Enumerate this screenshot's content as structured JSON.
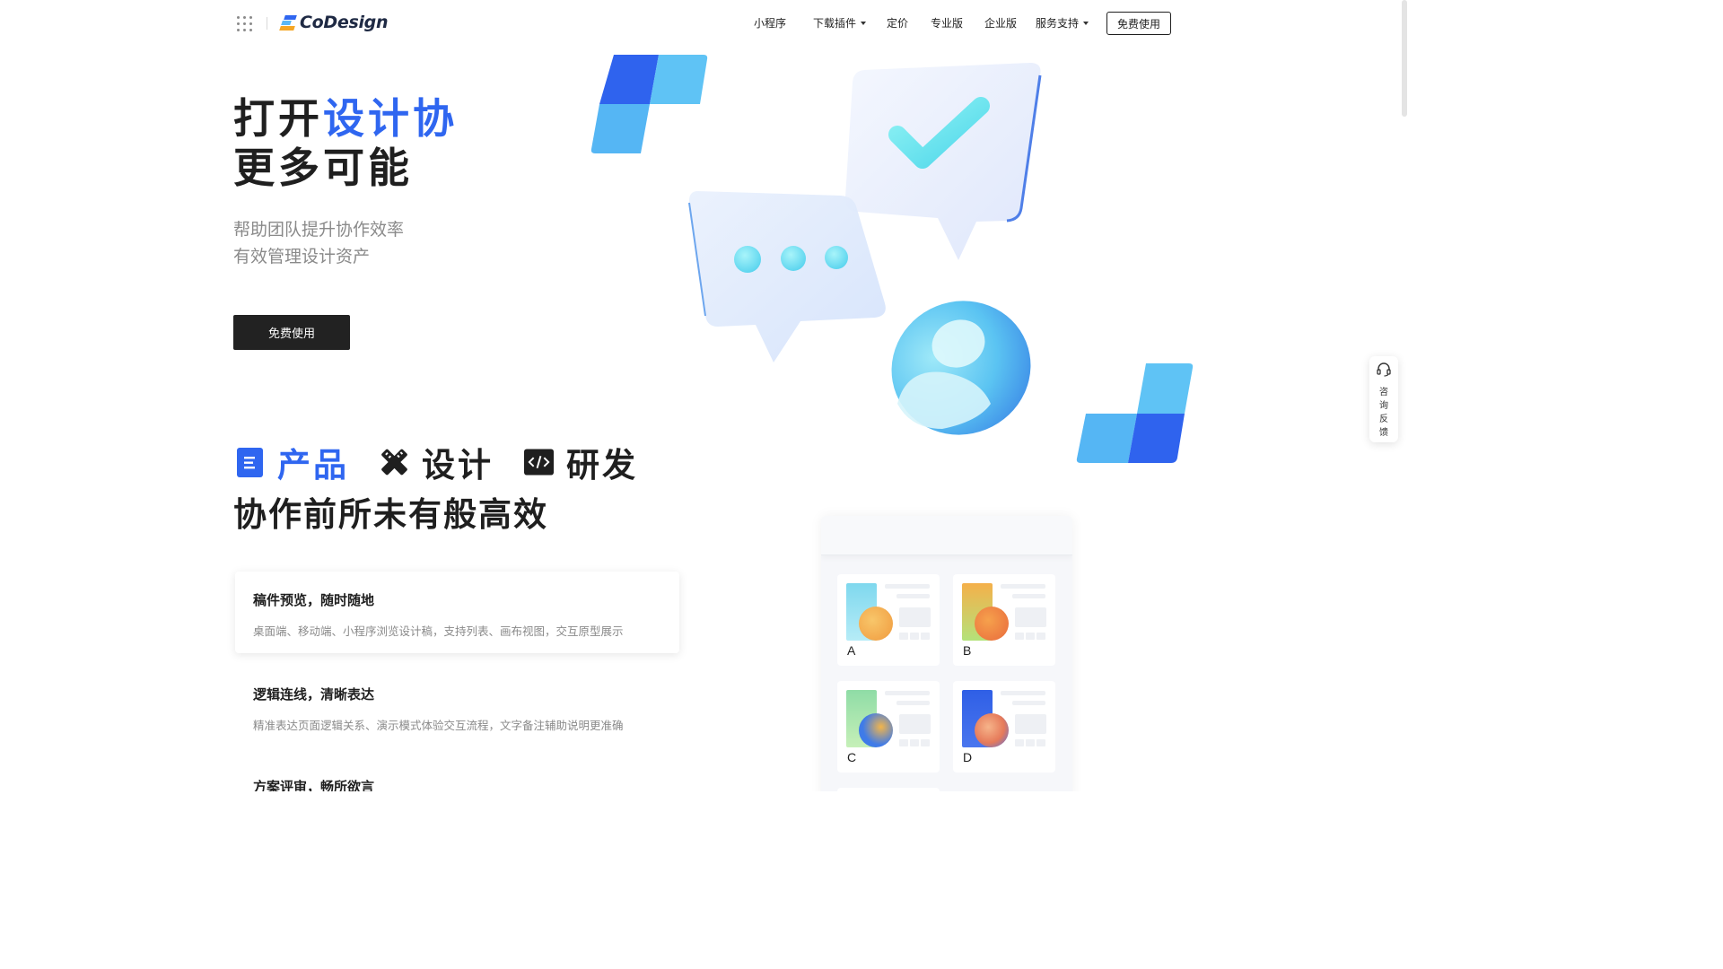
{
  "header": {
    "logo_text": "CoDesign",
    "nav": [
      {
        "label": "小程序",
        "dropdown": false
      },
      {
        "label": "下载插件",
        "dropdown": true
      },
      {
        "label": "定价",
        "dropdown": false
      },
      {
        "label": "专业版",
        "dropdown": false
      },
      {
        "label": "企业版",
        "dropdown": false
      },
      {
        "label": "服务支持",
        "dropdown": true
      }
    ],
    "cta_label": "免费使用"
  },
  "hero": {
    "title_part1": "打开",
    "title_highlight": "设计协",
    "title_line2": "更多可能",
    "subtitle_line1": "帮助团队提升协作效率",
    "subtitle_line2": "有效管理设计资产",
    "cta_label": "免费使用"
  },
  "section": {
    "categories": [
      {
        "label": "产品",
        "icon": "document-icon",
        "active": true
      },
      {
        "label": "设计",
        "icon": "design-tools-icon",
        "active": false
      },
      {
        "label": "研发",
        "icon": "code-icon",
        "active": false
      }
    ],
    "title": "协作前所未有般高效",
    "features": [
      {
        "title": "稿件预览，随时随地",
        "desc": "桌面端、移动端、小程序浏览设计稿，支持列表、画布视图，交互原型展示",
        "active": true
      },
      {
        "title": "逻辑连线，清晰表达",
        "desc": "精准表达页面逻辑关系、演示模式体验交互流程，文字备注辅助说明更准确",
        "active": false
      },
      {
        "title": "方案评审，畅所欲言",
        "desc": "",
        "active": false
      }
    ]
  },
  "preview": {
    "cards": [
      {
        "label": "A",
        "swatch": "#7fd8ee",
        "ball": "#f3a64a"
      },
      {
        "label": "B",
        "swatch": "#f5b04a",
        "ball": "#ef7a45"
      },
      {
        "label": "C",
        "swatch": "#8fdca6",
        "ball": "#3f7be8"
      },
      {
        "label": "D",
        "swatch": "#2f5fe6",
        "ball": "#f0a07a"
      }
    ]
  },
  "side_widget": {
    "label": "咨询反馈",
    "icon": "headset-icon"
  },
  "colors": {
    "accent": "#2f66f0",
    "dark_button": "#222222",
    "muted_text": "#8a8a8a"
  }
}
